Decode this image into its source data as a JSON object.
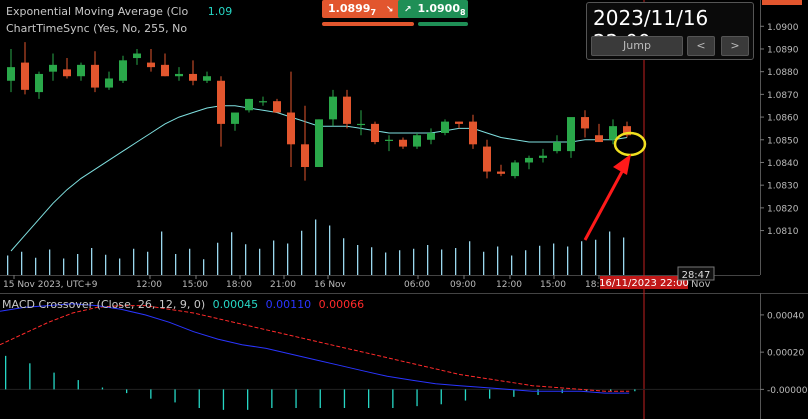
{
  "indicators": {
    "ema_label": "Exponential Moving Average (Clo",
    "ema_value": "1.09",
    "sync_label": "ChartTimeSync (Yes, No, 255, No"
  },
  "trade_panel": {
    "sell_price": "1.0899",
    "sell_sup": "7",
    "buy_price": "1.0900",
    "buy_sup": "8",
    "sell_color": "#e2562e",
    "buy_color": "#1f8f56"
  },
  "jump_box": {
    "datetime": "2023/11/16 22:00",
    "jump_label": "Jump",
    "prev_label": "<",
    "next_label": ">"
  },
  "crosshair": {
    "time_label": "16/11/2023 22:00",
    "bar_countdown": "28:47",
    "right_axis_fragment": "Nov"
  },
  "macd": {
    "label": "MACD Crossover (Close, 26, 12, 9, 0)",
    "hist_value": "0.00045",
    "macd_value": "0.00110",
    "signal_value": "0.00066",
    "hist_color": "#26d7c5",
    "macd_color": "#2a35ff",
    "signal_color": "#ff2a2a",
    "yticks": [
      "0.00040",
      "0.00020",
      "-0.00000"
    ]
  },
  "colors": {
    "bull": "#2aa84a",
    "bear": "#e2562e",
    "ema": "#7fe0e0",
    "volume": "#9ad8ee",
    "crosshair": "#d33",
    "marker_circle": "#f0e020",
    "arrow": "#ff1a1a"
  },
  "chart_data": [
    {
      "type": "candlestick",
      "title": "",
      "xlabel": "",
      "ylabel": "",
      "ylim": [
        1.0801,
        1.0901
      ],
      "yticks": [
        "1.0900",
        "1.0890",
        "1.0880",
        "1.0870",
        "1.0860",
        "1.0850",
        "1.0840",
        "1.0830",
        "1.0820",
        "1.0810"
      ],
      "xticks": [
        "15 Nov 2023, UTC+9",
        "12:00",
        "15:00",
        "18:00",
        "21:00",
        "16 Nov",
        "06:00",
        "09:00",
        "12:00",
        "15:00",
        "18:"
      ],
      "candles": [
        {
          "o": 1.0876,
          "h": 1.089,
          "l": 1.0871,
          "c": 1.0882
        },
        {
          "o": 1.0884,
          "h": 1.0893,
          "l": 1.087,
          "c": 1.0872
        },
        {
          "o": 1.0871,
          "h": 1.088,
          "l": 1.0868,
          "c": 1.0879
        },
        {
          "o": 1.088,
          "h": 1.0888,
          "l": 1.0876,
          "c": 1.0883
        },
        {
          "o": 1.0881,
          "h": 1.0886,
          "l": 1.0877,
          "c": 1.0878
        },
        {
          "o": 1.0878,
          "h": 1.0884,
          "l": 1.0876,
          "c": 1.0883
        },
        {
          "o": 1.0883,
          "h": 1.0889,
          "l": 1.0871,
          "c": 1.0873
        },
        {
          "o": 1.0873,
          "h": 1.088,
          "l": 1.0872,
          "c": 1.0877
        },
        {
          "o": 1.0876,
          "h": 1.0887,
          "l": 1.0875,
          "c": 1.0885
        },
        {
          "o": 1.0886,
          "h": 1.089,
          "l": 1.0883,
          "c": 1.0888
        },
        {
          "o": 1.0884,
          "h": 1.089,
          "l": 1.088,
          "c": 1.0882
        },
        {
          "o": 1.0883,
          "h": 1.0888,
          "l": 1.0878,
          "c": 1.0878
        },
        {
          "o": 1.0878,
          "h": 1.0882,
          "l": 1.0876,
          "c": 1.0879
        },
        {
          "o": 1.0879,
          "h": 1.0885,
          "l": 1.0874,
          "c": 1.0876
        },
        {
          "o": 1.0876,
          "h": 1.088,
          "l": 1.0875,
          "c": 1.0878
        },
        {
          "o": 1.0876,
          "h": 1.0878,
          "l": 1.0847,
          "c": 1.0857
        },
        {
          "o": 1.0857,
          "h": 1.086,
          "l": 1.0854,
          "c": 1.0862
        },
        {
          "o": 1.0863,
          "h": 1.0868,
          "l": 1.0862,
          "c": 1.0868
        },
        {
          "o": 1.0867,
          "h": 1.0869,
          "l": 1.0865,
          "c": 1.0867
        },
        {
          "o": 1.0867,
          "h": 1.0868,
          "l": 1.0862,
          "c": 1.0862
        },
        {
          "o": 1.0862,
          "h": 1.088,
          "l": 1.0838,
          "c": 1.0848
        },
        {
          "o": 1.0848,
          "h": 1.0865,
          "l": 1.0832,
          "c": 1.0838
        },
        {
          "o": 1.0838,
          "h": 1.0859,
          "l": 1.0838,
          "c": 1.0859
        },
        {
          "o": 1.0859,
          "h": 1.0872,
          "l": 1.0856,
          "c": 1.0869
        },
        {
          "o": 1.0869,
          "h": 1.0872,
          "l": 1.0855,
          "c": 1.0857
        },
        {
          "o": 1.0857,
          "h": 1.0863,
          "l": 1.0852,
          "c": 1.0857
        },
        {
          "o": 1.0857,
          "h": 1.0858,
          "l": 1.0848,
          "c": 1.0849
        },
        {
          "o": 1.085,
          "h": 1.0852,
          "l": 1.0845,
          "c": 1.085
        },
        {
          "o": 1.085,
          "h": 1.0851,
          "l": 1.0846,
          "c": 1.0847
        },
        {
          "o": 1.0847,
          "h": 1.0853,
          "l": 1.0846,
          "c": 1.0852
        },
        {
          "o": 1.085,
          "h": 1.0855,
          "l": 1.0848,
          "c": 1.0853
        },
        {
          "o": 1.0853,
          "h": 1.0859,
          "l": 1.0852,
          "c": 1.0858
        },
        {
          "o": 1.0858,
          "h": 1.0858,
          "l": 1.0855,
          "c": 1.0857
        },
        {
          "o": 1.0858,
          "h": 1.0861,
          "l": 1.0846,
          "c": 1.0848
        },
        {
          "o": 1.0847,
          "h": 1.085,
          "l": 1.0833,
          "c": 1.0836
        },
        {
          "o": 1.0836,
          "h": 1.0839,
          "l": 1.0834,
          "c": 1.0835
        },
        {
          "o": 1.0834,
          "h": 1.0841,
          "l": 1.0833,
          "c": 1.084
        },
        {
          "o": 1.084,
          "h": 1.0843,
          "l": 1.0837,
          "c": 1.0842
        },
        {
          "o": 1.0842,
          "h": 1.0846,
          "l": 1.084,
          "c": 1.0843
        },
        {
          "o": 1.0845,
          "h": 1.0852,
          "l": 1.0844,
          "c": 1.0849
        },
        {
          "o": 1.0845,
          "h": 1.0855,
          "l": 1.0842,
          "c": 1.086
        },
        {
          "o": 1.086,
          "h": 1.0863,
          "l": 1.0851,
          "c": 1.0855
        },
        {
          "o": 1.0852,
          "h": 1.0857,
          "l": 1.0849,
          "c": 1.0849
        },
        {
          "o": 1.085,
          "h": 1.0859,
          "l": 1.0848,
          "c": 1.0856
        },
        {
          "o": 1.0856,
          "h": 1.0858,
          "l": 1.0851,
          "c": 1.0852
        }
      ],
      "ema": [
        1.0801,
        1.0808,
        1.0815,
        1.0822,
        1.0828,
        1.0833,
        1.0837,
        1.0841,
        1.0845,
        1.0849,
        1.0853,
        1.0857,
        1.086,
        1.0862,
        1.0864,
        1.0865,
        1.0865,
        1.0864,
        1.0863,
        1.0862,
        1.086,
        1.0858,
        1.0856,
        1.0856,
        1.0856,
        1.0855,
        1.0854,
        1.0853,
        1.0853,
        1.0853,
        1.0853,
        1.0854,
        1.0855,
        1.0855,
        1.0853,
        1.0851,
        1.085,
        1.0849,
        1.0849,
        1.0849,
        1.0849,
        1.085,
        1.085,
        1.085,
        1.0851
      ],
      "volume": [
        26,
        31,
        23,
        34,
        22,
        28,
        36,
        27,
        22,
        35,
        31,
        58,
        28,
        35,
        21,
        43,
        57,
        41,
        35,
        46,
        42,
        59,
        74,
        66,
        49,
        40,
        37,
        30,
        33,
        35,
        40,
        34,
        36,
        45,
        31,
        38,
        26,
        33,
        39,
        42,
        38,
        45,
        47,
        58,
        50
      ]
    },
    {
      "type": "line",
      "title": "",
      "xlabel": "",
      "ylabel": "",
      "ylim": [
        -0.0001,
        0.00048
      ],
      "series": [
        {
          "name": "MACD",
          "values": [
            0.00042,
            0.00044,
            0.00045,
            0.00046,
            0.00045,
            0.00043,
            0.0004,
            0.00036,
            0.00031,
            0.00027,
            0.00024,
            0.00022,
            0.00019,
            0.00016,
            0.00013,
            0.0001,
            7e-05,
            5e-05,
            3e-05,
            2e-05,
            1e-05,
            0.0,
            -1e-05,
            -1e-05,
            -1e-05,
            -2e-05,
            -2e-05
          ]
        },
        {
          "name": "Signal",
          "values": [
            0.00024,
            0.0003,
            0.00036,
            0.00041,
            0.00044,
            0.00045,
            0.00045,
            0.00043,
            0.00041,
            0.00038,
            0.00035,
            0.00032,
            0.00029,
            0.00026,
            0.00023,
            0.0002,
            0.00017,
            0.00014,
            0.00011,
            8e-05,
            6e-05,
            4e-05,
            2e-05,
            1e-05,
            0.0,
            -1e-05,
            -1e-05
          ]
        },
        {
          "name": "Histogram",
          "values": [
            0.00018,
            0.00014,
            9e-05,
            5e-05,
            1e-05,
            -2e-05,
            -5e-05,
            -7e-05,
            -0.0001,
            -0.00011,
            -0.00011,
            -0.0001,
            -0.0001,
            -0.0001,
            -0.0001,
            -0.0001,
            -0.0001,
            -9e-05,
            -8e-05,
            -6e-05,
            -5e-05,
            -4e-05,
            -3e-05,
            -2e-05,
            -1e-05,
            -1e-05,
            -1e-05
          ]
        }
      ]
    }
  ]
}
